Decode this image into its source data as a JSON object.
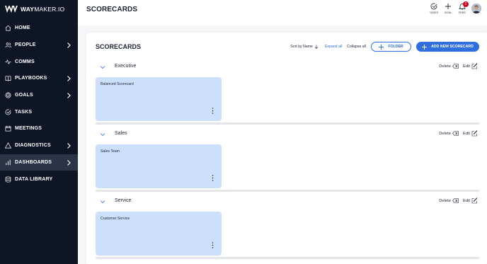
{
  "app": {
    "logo_bold": "WAY",
    "logo_rest": "MAKER.IO"
  },
  "sidebar": {
    "items": [
      {
        "label": "HOME",
        "icon": "home-icon",
        "chevron": false,
        "active": false
      },
      {
        "label": "PEOPLE",
        "icon": "people-icon",
        "chevron": true,
        "active": false
      },
      {
        "label": "COMMS",
        "icon": "comms-icon",
        "chevron": false,
        "active": false
      },
      {
        "label": "PLAYBOOKS",
        "icon": "book-icon",
        "chevron": true,
        "active": false
      },
      {
        "label": "GOALS",
        "icon": "target-icon",
        "chevron": true,
        "active": false
      },
      {
        "label": "TASKS",
        "icon": "check-circle-icon",
        "chevron": false,
        "active": false
      },
      {
        "label": "MEETINGS",
        "icon": "calendar-icon",
        "chevron": false,
        "active": false
      },
      {
        "label": "DIAGNOSTICS",
        "icon": "triangle-icon",
        "chevron": true,
        "active": false
      },
      {
        "label": "DASHBOARDS",
        "icon": "bar-chart-icon",
        "chevron": true,
        "active": true
      },
      {
        "label": "DATA LIBRARY",
        "icon": "database-icon",
        "chevron": false,
        "active": false
      }
    ]
  },
  "header": {
    "title": "SCORECARDS",
    "actions": [
      {
        "label": "TASKS",
        "icon": "task-check-icon"
      },
      {
        "label": "GOAL",
        "icon": "plus-icon"
      },
      {
        "label": "FEED",
        "icon": "bell-icon",
        "badge": "2"
      }
    ]
  },
  "main": {
    "title": "SCORECARDS",
    "sort_label": "Sort by Name",
    "expand_all": "Expand all",
    "collapse_all": "Collapse all",
    "folder_button": "FOLDER",
    "add_button": "ADD NEW SCORECARD",
    "groups": [
      {
        "name": "Executive",
        "delete_label": "Delete",
        "edit_label": "Edit",
        "cards": [
          {
            "title": "Balanced Scorecard"
          }
        ]
      },
      {
        "name": "Sales",
        "delete_label": "Delete",
        "edit_label": "Edit",
        "cards": [
          {
            "title": "Sales Team"
          }
        ]
      },
      {
        "name": "Service",
        "delete_label": "Delete",
        "edit_label": "Edit",
        "cards": [
          {
            "title": "Customer Service"
          }
        ]
      }
    ]
  },
  "colors": {
    "sidebar_bg": "#0e1525",
    "sidebar_active": "#2b3447",
    "accent": "#2f6fe0",
    "card_bg": "#cde0fb",
    "badge": "#d0021b"
  }
}
